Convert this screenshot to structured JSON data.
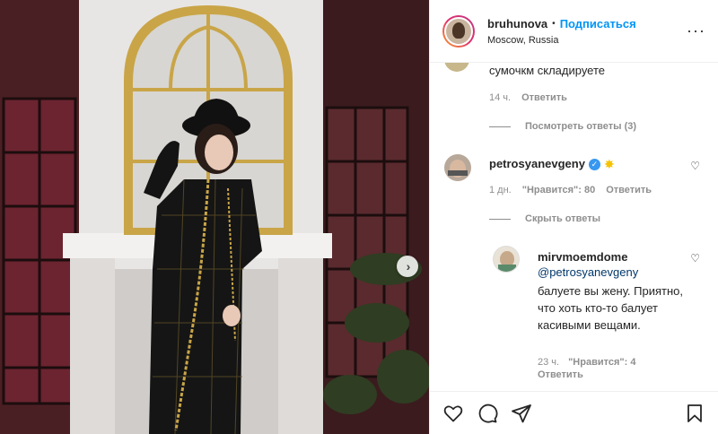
{
  "header": {
    "username": "bruhunova",
    "follow_label": "Подписаться",
    "location": "Moscow, Russia",
    "more_label": "···"
  },
  "comments": {
    "top_comment": {
      "text": "сумочкм складируете",
      "time": "14 ч.",
      "reply_label": "Ответить",
      "view_replies": "Посмотреть ответы (3)"
    },
    "petrosyan": {
      "username": "petrosyanevgeny",
      "time": "1 дн.",
      "likes": "\"Нравится\": 80",
      "reply_label": "Ответить",
      "hide_replies": "Скрыть ответы"
    },
    "reply": {
      "username": "mirvmoemdome",
      "mention": "@petrosyanevgeny",
      "text": "балуете вы жену. Приятно, что хоть кто-то балует касивыми вещами.",
      "time": "23 ч.",
      "likes": "\"Нравится\": 4",
      "reply_label": "Ответить"
    }
  },
  "icons": {
    "next": "chevron-right-icon",
    "heart": "heart-icon",
    "comment": "comment-icon",
    "share": "share-icon",
    "save": "bookmark-icon"
  },
  "colors": {
    "accent": "#0095f6",
    "verified": "#3897f0",
    "meta": "#8e8e8e"
  }
}
